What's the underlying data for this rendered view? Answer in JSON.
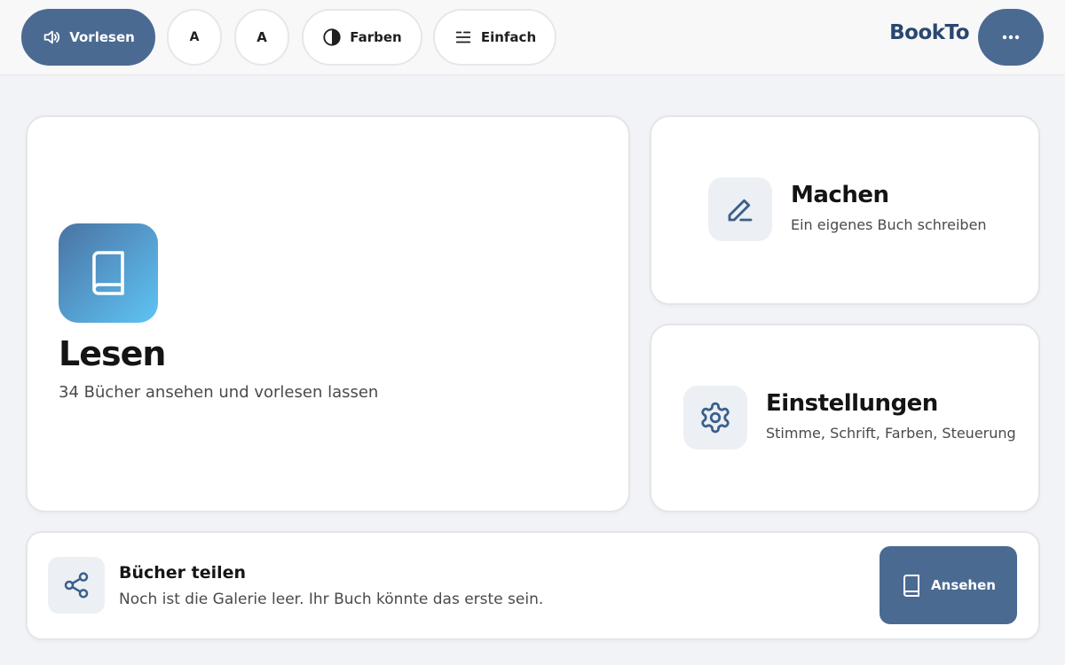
{
  "toolbar": {
    "read_aloud_label": "Vorlesen",
    "font_smaller_label": "A",
    "font_larger_label": "A",
    "colors_label": "Farben",
    "simple_label": "Einfach",
    "brand": "BookTo",
    "more_icon": "more-horizontal-icon"
  },
  "cards": {
    "read": {
      "title": "Lesen",
      "subtitle": "34 Bücher ansehen und vorlesen lassen",
      "icon": "book-icon"
    },
    "make": {
      "title": "Machen",
      "subtitle": "Ein eigenes Buch schreiben",
      "icon": "pencil-icon"
    },
    "settings": {
      "title": "Einstellungen",
      "subtitle": "Stimme, Schrift, Farben, Steuerung",
      "icon": "gear-icon"
    }
  },
  "share": {
    "title": "Bücher teilen",
    "subtitle": "Noch ist die Galerie leer. Ihr Buch könnte das erste sein.",
    "button_label": "Ansehen",
    "icon": "share-icon"
  },
  "colors": {
    "primary": "#4b6a92",
    "brand": "#2a4770",
    "background": "#f2f3f6",
    "tile": "#eceff3",
    "gradient_start": "#4a73a3",
    "gradient_end": "#5ec4f5"
  }
}
